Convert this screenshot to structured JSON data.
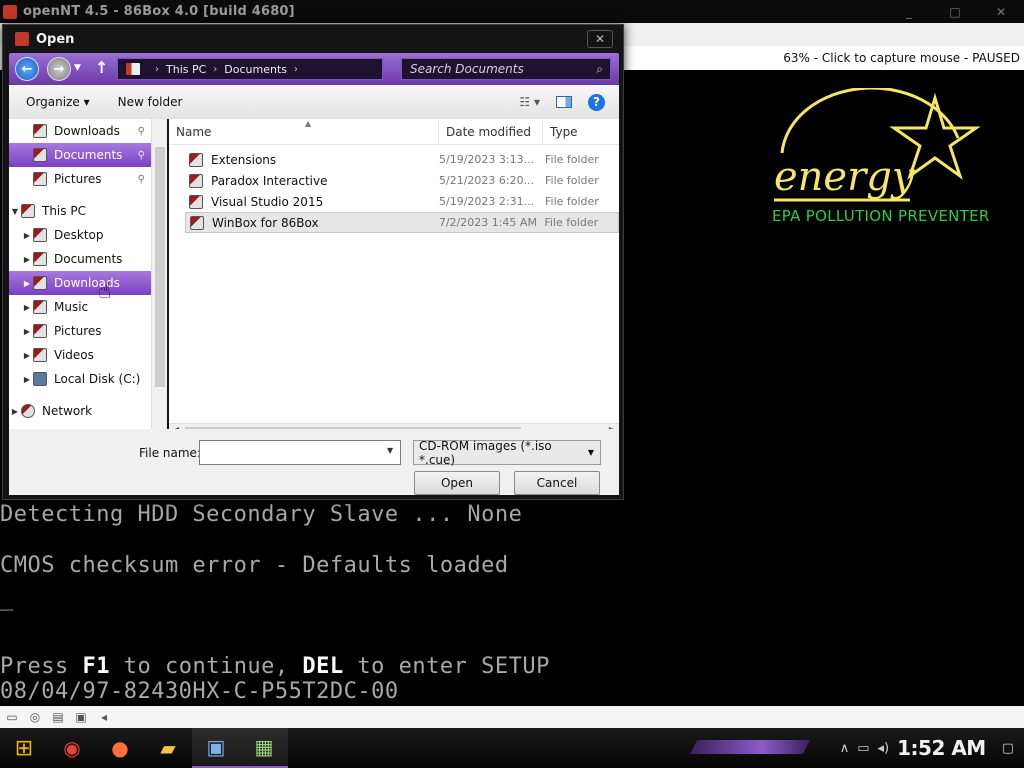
{
  "host": {
    "window_title": "openNT 4.5 - 86Box 4.0 [build 4680]",
    "status_message": "63% - Click to capture mouse - PAUSED",
    "window_controls": [
      "_",
      "□",
      "✕"
    ]
  },
  "bios": {
    "energy_caption": "EPA POLLUTION PREVENTER",
    "energy_logo_text": "energy",
    "lines": {
      "hdd": "Detecting HDD Secondary Slave ... None",
      "cmos": "CMOS checksum error - Defaults loaded",
      "cursor": "_",
      "press_prefix": "Press ",
      "press_f1": "F1",
      "press_mid": " to continue, ",
      "press_del": "DEL",
      "press_suffix": " to enter SETUP",
      "bios_id": "08/04/97-82430HX-C-P55T2DC-00"
    }
  },
  "dialog": {
    "title": "Open",
    "close_glyph": "✕",
    "breadcrumb": [
      "This PC",
      "Documents"
    ],
    "search_placeholder": "Search Documents",
    "organize_label": "Organize ▾",
    "new_folder_label": "New folder",
    "nav_items": [
      {
        "label": "Downloads",
        "pinned": true
      },
      {
        "label": "Documents",
        "pinned": true
      },
      {
        "label": "Pictures",
        "pinned": true
      },
      {
        "label": "This PC"
      },
      {
        "label": "Desktop"
      },
      {
        "label": "Documents"
      },
      {
        "label": "Downloads"
      },
      {
        "label": "Music"
      },
      {
        "label": "Pictures"
      },
      {
        "label": "Videos"
      },
      {
        "label": "Local Disk (C:)"
      },
      {
        "label": "Network"
      }
    ],
    "columns": {
      "name": "Name",
      "date": "Date modified",
      "type": "Type"
    },
    "files": [
      {
        "name": "Extensions",
        "date": "5/19/2023 3:13...",
        "type": "File folder"
      },
      {
        "name": "Paradox Interactive",
        "date": "5/21/2023 6:20...",
        "type": "File folder"
      },
      {
        "name": "Visual Studio 2015",
        "date": "5/19/2023 2:31...",
        "type": "File folder"
      },
      {
        "name": "WinBox for 86Box",
        "date": "7/2/2023 1:45 AM",
        "type": "File folder"
      }
    ],
    "file_name_label": "File name:",
    "file_name_value": "",
    "filter_value": "CD-ROM images (*.iso *.cue)",
    "open_label": "Open",
    "cancel_label": "Cancel"
  },
  "taskbar": {
    "clock": "1:52 AM",
    "apps": [
      "start-icon",
      "chrome-icon",
      "firefox-icon",
      "file-explorer-icon",
      "winbox-icon",
      "86box-icon"
    ]
  }
}
